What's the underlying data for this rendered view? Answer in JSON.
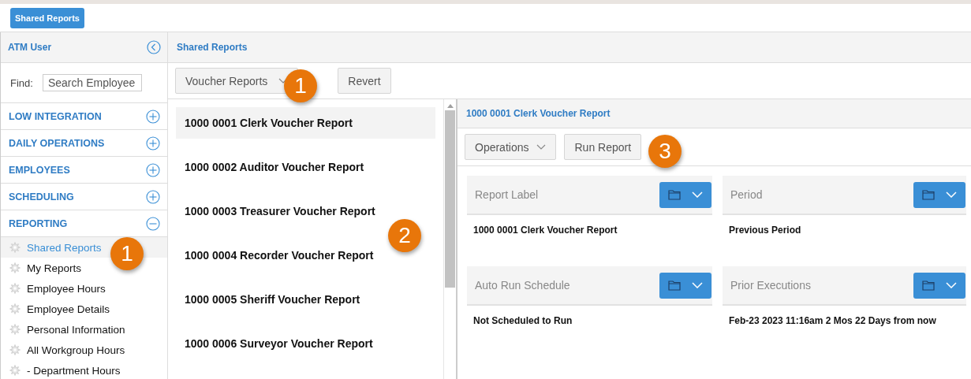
{
  "top_button": "Shared Reports",
  "sidebar": {
    "user": "ATM User",
    "find_label": "Find:",
    "search": {
      "placeholder": "Search Employee"
    },
    "sections": [
      {
        "label": "LOW INTEGRATION",
        "expanded": false
      },
      {
        "label": "DAILY OPERATIONS",
        "expanded": false
      },
      {
        "label": "EMPLOYEES",
        "expanded": false
      },
      {
        "label": "SCHEDULING",
        "expanded": false
      },
      {
        "label": "REPORTING",
        "expanded": true
      }
    ],
    "items": [
      {
        "label": "Shared Reports",
        "selected": true
      },
      {
        "label": "My Reports",
        "selected": false
      },
      {
        "label": "Employee Hours",
        "selected": false
      },
      {
        "label": "Employee Details",
        "selected": false
      },
      {
        "label": "Personal Information",
        "selected": false
      },
      {
        "label": "All Workgroup Hours",
        "selected": false
      },
      {
        "label": "- Department Hours",
        "selected": false
      }
    ]
  },
  "breadcrumb": "Shared Reports",
  "toolbar": {
    "dropdown": "Voucher Reports",
    "button": "Revert"
  },
  "reports": [
    {
      "label": "1000 0001 Clerk Voucher Report",
      "selected": true
    },
    {
      "label": "1000 0002 Auditor Voucher Report",
      "selected": false
    },
    {
      "label": "1000 0003 Treasurer Voucher Report",
      "selected": false
    },
    {
      "label": "1000 0004 Recorder Voucher Report",
      "selected": false
    },
    {
      "label": "1000 0005 Sheriff Voucher Report",
      "selected": false
    },
    {
      "label": "1000 0006 Surveyor Voucher Report",
      "selected": false
    }
  ],
  "detail": {
    "title": "1000 0001 Clerk Voucher Report",
    "operations": "Operations",
    "run": "Run Report",
    "cards": [
      {
        "title": "Report Label",
        "value": "1000 0001 Clerk Voucher Report"
      },
      {
        "title": "Period",
        "value": "Previous Period"
      },
      {
        "title": "Auto Run Schedule",
        "value": "Not Scheduled to Run"
      },
      {
        "title": "Prior Executions",
        "value": "Feb-23 2023 11:16am 2 Mos 22 Days from now"
      }
    ]
  },
  "callouts": [
    {
      "number": "1"
    },
    {
      "number": "1"
    },
    {
      "number": "2"
    },
    {
      "number": "3"
    }
  ]
}
